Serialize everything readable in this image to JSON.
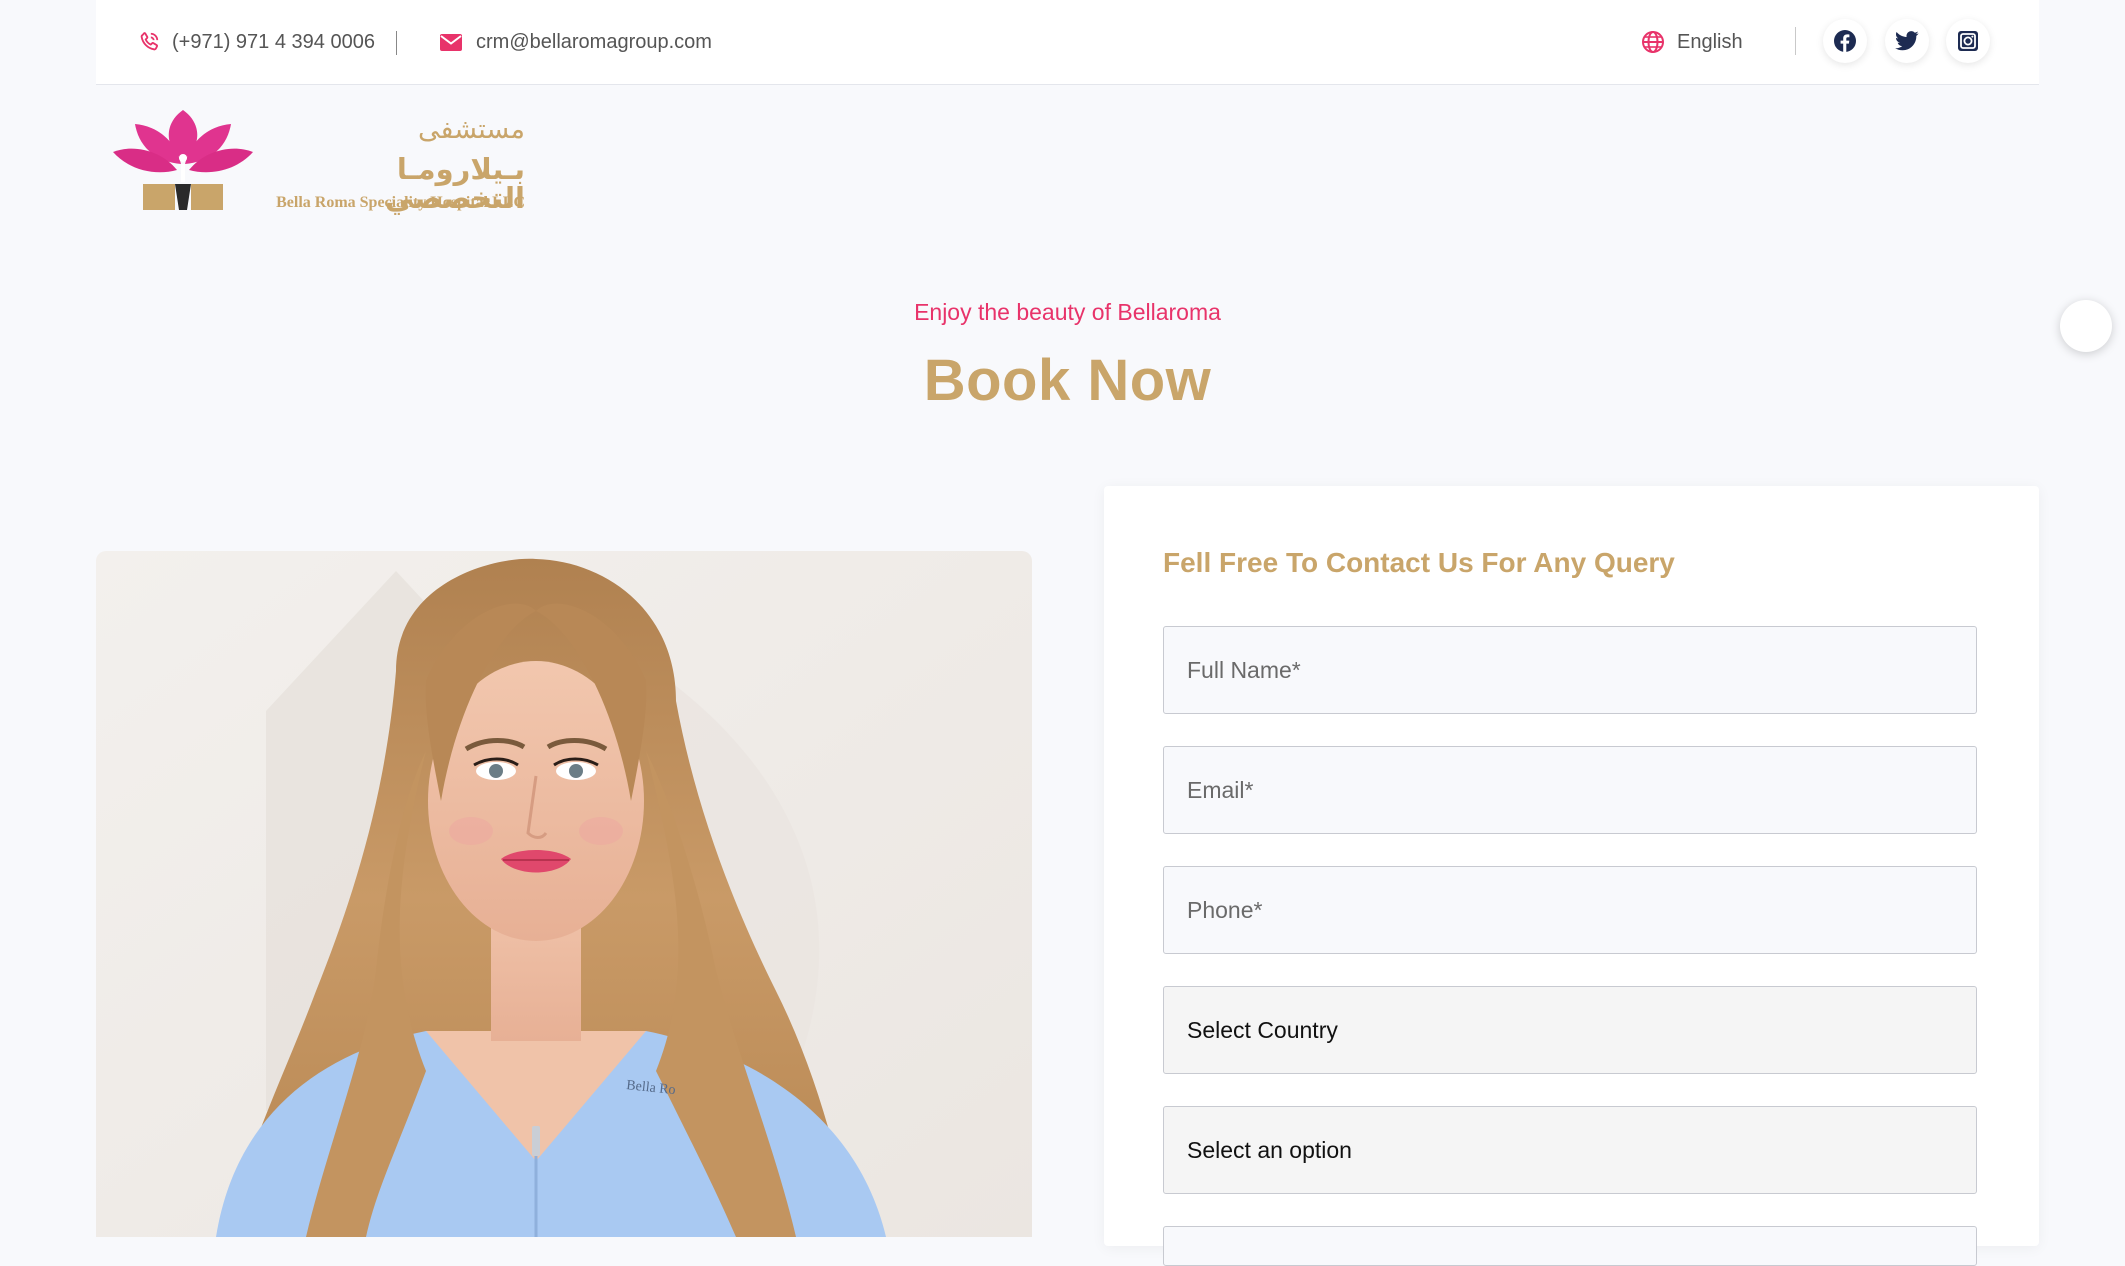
{
  "topbar": {
    "phone": "(+971) 971 4 394 0006",
    "email": "crm@bellaromagroup.com",
    "language": "English",
    "social": [
      "facebook-icon",
      "twitter-icon",
      "instagram-icon"
    ]
  },
  "logo": {
    "arabic_line1": "مستشفى",
    "arabic_line2": "بـيلارومـا التخصصي",
    "english": "Bella Roma Speciality Hospital LLC"
  },
  "hero": {
    "tagline": "Enjoy the beauty of Bellaroma",
    "title": "Book Now"
  },
  "form": {
    "title": "Fell Free To Contact Us For Any Query",
    "full_name_placeholder": "Full Name*",
    "email_placeholder": "Email*",
    "phone_placeholder": "Phone*",
    "country_select": "Select Country",
    "option_select": "Select an option"
  },
  "colors": {
    "accent_gold": "#c9a56a",
    "accent_pink": "#e8336a",
    "icon_navy": "#1d2b52",
    "background": "#f8f9fc"
  }
}
